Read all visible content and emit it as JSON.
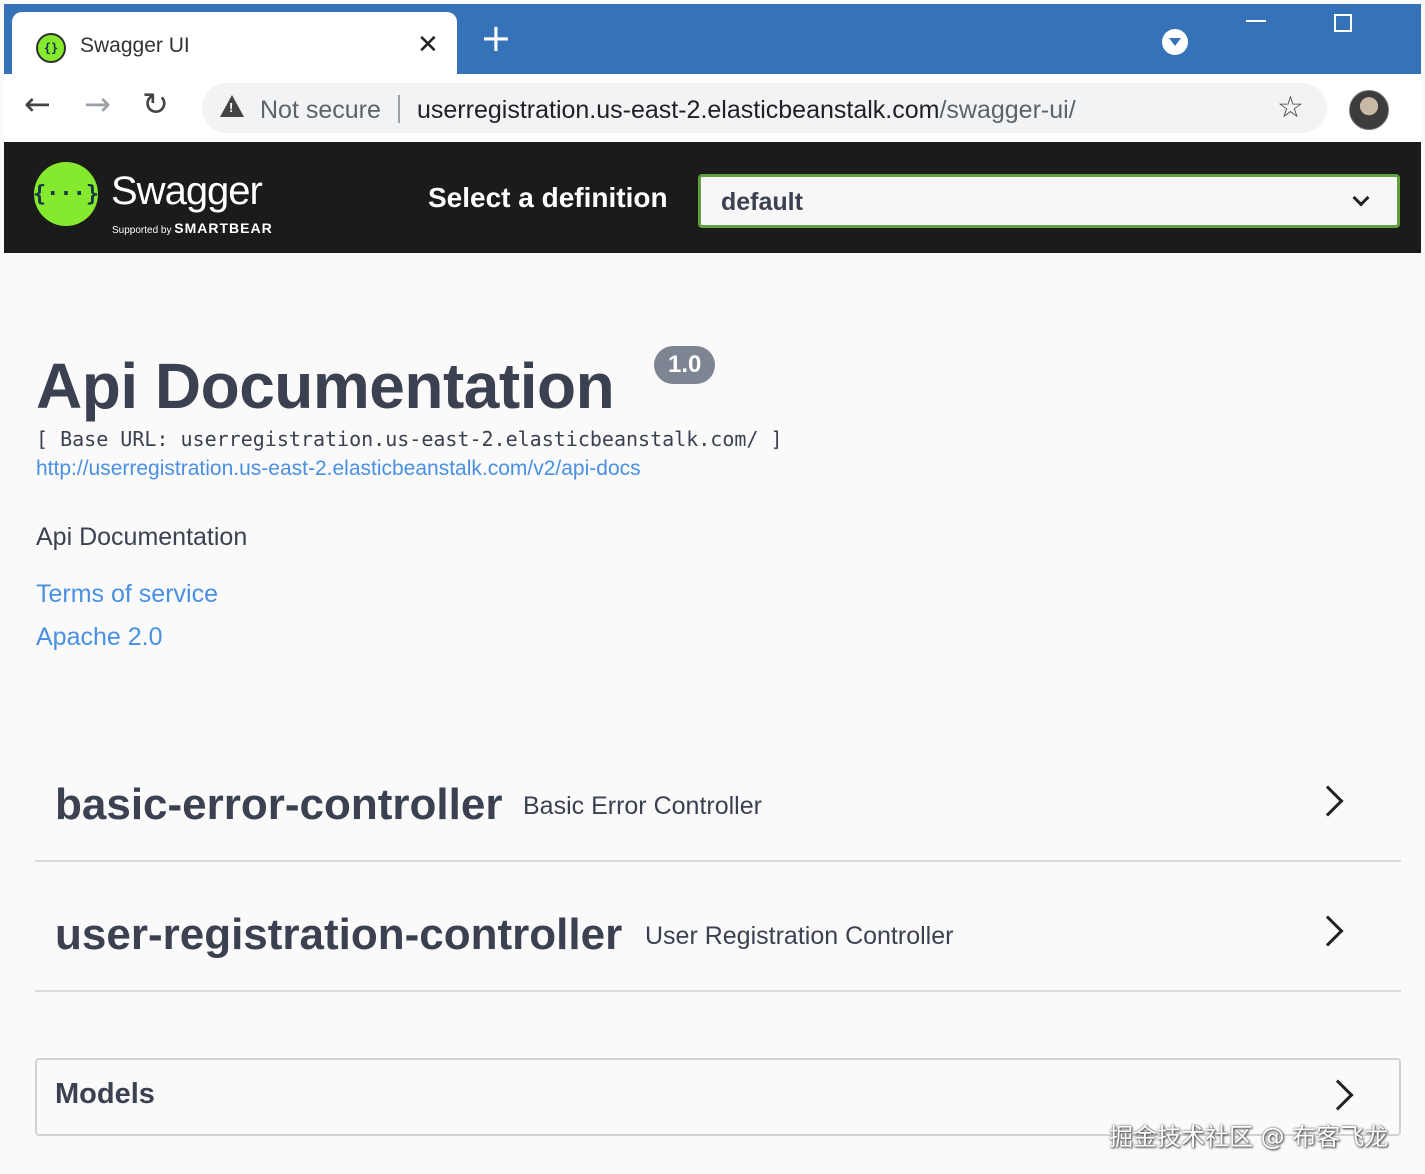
{
  "browser": {
    "tab_title": "Swagger UI",
    "tab_close": "✕",
    "new_tab": "+",
    "security_label": "Not secure",
    "url_host": "userregistration.us-east-2.elasticbeanstalk.com",
    "url_path": "/swagger-ui/",
    "icons": [
      "swagger-favicon-icon",
      "close-icon",
      "plus-icon",
      "tab-search-icon",
      "minimize-icon",
      "maximize-icon",
      "back-icon",
      "forward-icon",
      "reload-icon",
      "warning-icon",
      "star-icon",
      "avatar"
    ]
  },
  "topbar": {
    "logo_name": "Swagger",
    "logo_supported": "Supported by",
    "logo_brand": "SMARTBEAR",
    "select_label": "Select a definition",
    "definition_value": "default",
    "accent": "#85ea2d",
    "bar_color": "#1b1b1b",
    "select_border": "#62a03f"
  },
  "info": {
    "title": "Api Documentation",
    "version": "1.0",
    "base_url": "[ Base URL: userregistration.us-east-2.elasticbeanstalk.com/ ]",
    "spec_url": "http://userregistration.us-east-2.elasticbeanstalk.com/v2/api-docs",
    "description": "Api Documentation",
    "terms": "Terms of service",
    "license": "Apache 2.0",
    "link_color": "#4990e2"
  },
  "tags": [
    {
      "name": "basic-error-controller",
      "description": "Basic Error Controller"
    },
    {
      "name": "user-registration-controller",
      "description": "User Registration Controller"
    }
  ],
  "models": {
    "title": "Models"
  },
  "watermark": "掘金技术社区 @ 布客飞龙"
}
